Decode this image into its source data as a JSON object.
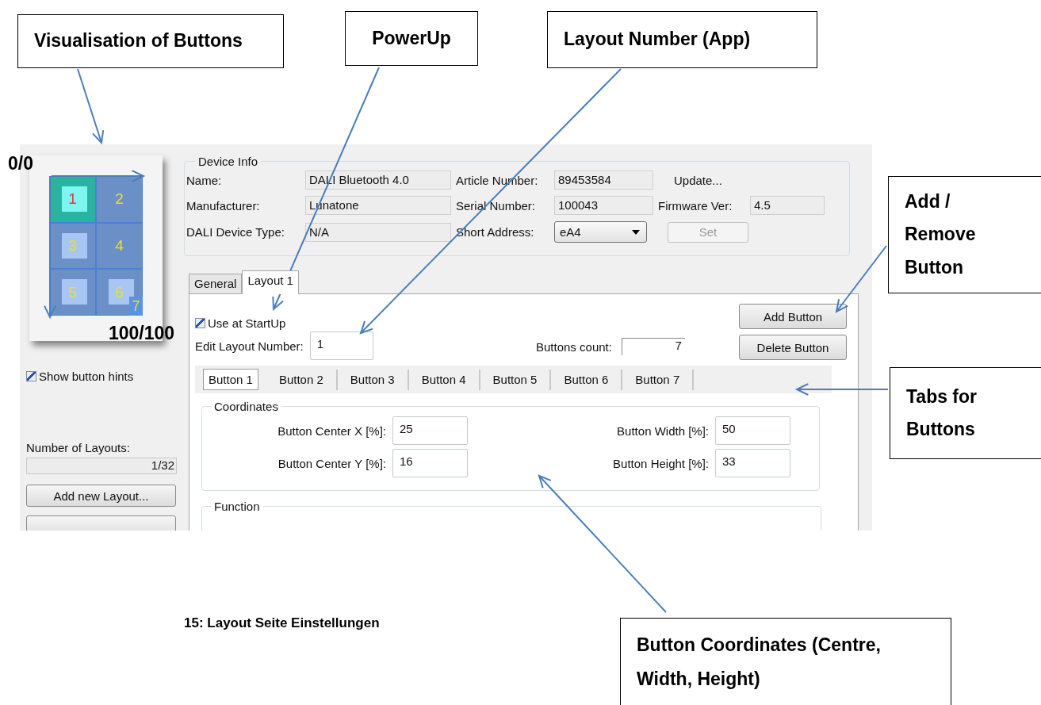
{
  "callouts": [
    {
      "text": "Visualisation of Buttons"
    },
    {
      "text": "PowerUp"
    },
    {
      "text": "Layout Number (App)"
    },
    {
      "text": "Add / Remove Button"
    },
    {
      "text": "Tabs for Buttons"
    },
    {
      "text": "Button Coordinates (Centre, Width, Height)"
    }
  ],
  "axis_labels": {
    "origin": "0/0",
    "end": "100/100"
  },
  "preview_buttons": [
    {
      "label": "1",
      "selected": true,
      "image": true
    },
    {
      "label": "2",
      "selected": false,
      "image": false
    },
    {
      "label": "3",
      "selected": false,
      "image": true
    },
    {
      "label": "4",
      "selected": false,
      "image": false
    },
    {
      "label": "5",
      "selected": false,
      "image": true
    },
    {
      "label": "6",
      "selected": false,
      "image": true
    },
    {
      "label": "7",
      "selected": false,
      "image": false
    }
  ],
  "show_button_hints": {
    "label": "Show button hints",
    "checked": true
  },
  "layouts": {
    "label": "Number of Layouts:",
    "value": "1/32",
    "add_button": "Add new Layout..."
  },
  "device_info": {
    "title": "Device Info",
    "fields": [
      {
        "label": "Name:",
        "value": "DALI Bluetooth 4.0",
        "kind": "text"
      },
      {
        "label": "Article Number:",
        "value": "89453584",
        "kind": "text"
      },
      {
        "label": "Update...",
        "kind": "link"
      },
      {
        "label": "Manufacturer:",
        "value": "Lunatone",
        "kind": "text"
      },
      {
        "label": "Serial Number:",
        "value": "100043",
        "kind": "text"
      },
      {
        "label": "Firmware Ver:",
        "value": "4.5",
        "kind": "text"
      },
      {
        "label": "DALI Device Type:",
        "value": "N/A",
        "kind": "text"
      },
      {
        "label": "Short Address:",
        "value": "eA4",
        "kind": "select"
      },
      {
        "label": "Set",
        "kind": "button",
        "disabled": true
      }
    ]
  },
  "tabs": [
    {
      "label": "General",
      "selected": false
    },
    {
      "label": "Layout 1",
      "selected": true
    }
  ],
  "layout": {
    "use_at_startup": {
      "label": "Use at StartUp",
      "checked": true
    },
    "layout_number": {
      "label": "Edit Layout Number:",
      "value": "1"
    },
    "buttons_count": {
      "label": "Buttons count:",
      "value": "7"
    },
    "actions": [
      "Add Button",
      "Delete Button"
    ],
    "button_tabs": [
      {
        "label": "Button 1",
        "selected": true
      },
      {
        "label": "Button 2",
        "selected": false
      },
      {
        "label": "Button 3",
        "selected": false
      },
      {
        "label": "Button 4",
        "selected": false
      },
      {
        "label": "Button 5",
        "selected": false
      },
      {
        "label": "Button 6",
        "selected": false
      },
      {
        "label": "Button 7",
        "selected": false
      }
    ],
    "coordinates": {
      "title": "Coordinates",
      "fields": [
        {
          "label": "Button Center X [%]:",
          "value": "25"
        },
        {
          "label": "Button Width [%]:",
          "value": "50"
        },
        {
          "label": "Button Center Y [%]:",
          "value": "16"
        },
        {
          "label": "Button Height [%]:",
          "value": "33"
        }
      ]
    },
    "function": {
      "title": "Function"
    }
  },
  "caption": "15: Layout Seite Einstellungen"
}
